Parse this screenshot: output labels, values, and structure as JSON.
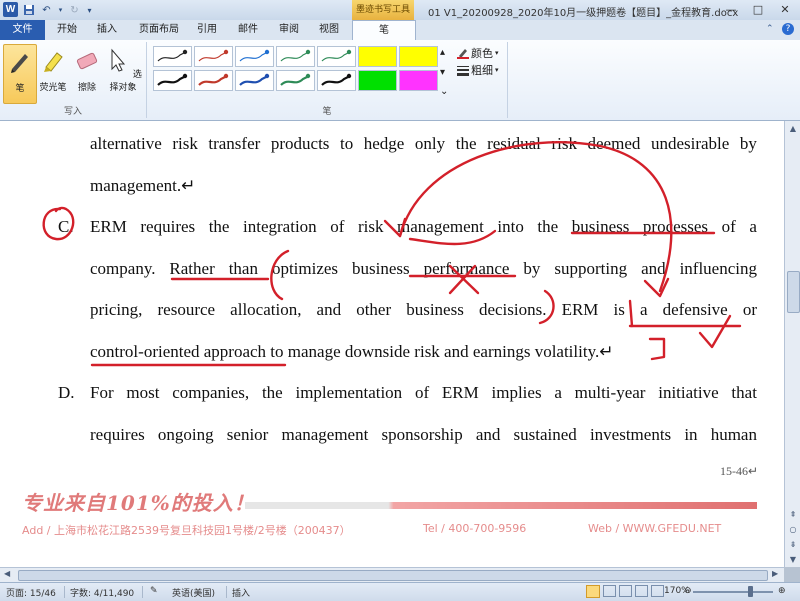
{
  "titlebar": {
    "app_icon": "W",
    "document_title": "01 V1_20200928_2020年10月一级押题卷【题目】_金程教育.docx",
    "context_tab_title": "墨迹书写工具",
    "window_controls": {
      "minimize": "—",
      "maximize": "□",
      "close": "✕"
    }
  },
  "tabs": {
    "file": "文件",
    "home": "开始",
    "insert": "插入",
    "page_layout": "页面布局",
    "references": "引用",
    "mailings": "邮件",
    "review": "审阅",
    "view": "视图",
    "pen": "笔"
  },
  "ribbon": {
    "write_group": {
      "label": "写入",
      "pen": "笔",
      "highlighter": "荧光笔",
      "eraser": "擦除",
      "select": "选择对象"
    },
    "pens_group": {
      "label": "笔",
      "color": "颜色",
      "weight": "粗细",
      "swatch_colors": [
        "#222222",
        "#c0392b",
        "#1f6fd1",
        "#2e8b57",
        "#2e8b57",
        "#ffff00",
        "#ffff00",
        "#111111",
        "#c0392b",
        "#1f4fb0",
        "#2e8b57",
        "#111111",
        "#00e000",
        "#ff33ff"
      ]
    }
  },
  "document": {
    "lines": [
      [
        "alternative",
        "risk",
        "transfer",
        "products",
        "to",
        "hedge",
        "only",
        "the",
        "residual",
        "risk",
        "deemed",
        "undesirable",
        "by"
      ],
      "management.↵",
      [
        "ERM",
        "requires",
        "the",
        "integration",
        "of",
        "risk",
        "management",
        "into",
        "the",
        "business",
        "processes",
        "of",
        "a"
      ],
      [
        "company.",
        "Rather",
        "than",
        "optimizes",
        "business",
        "performance",
        "by",
        "supporting",
        "and",
        "influencing"
      ],
      [
        "pricing,",
        "resource",
        "allocation,",
        "and",
        "other",
        "business",
        "decisions.",
        "ERM",
        "is",
        "a",
        "defensive",
        "or"
      ],
      "control-oriented approach to manage downside risk and earnings volatility.↵",
      [
        "For",
        "most",
        "companies,",
        "the",
        "implementation",
        "of",
        "ERM",
        "implies",
        "a",
        "multi-year",
        "initiative",
        "that"
      ],
      [
        "requires",
        "ongoing",
        "senior",
        "management",
        "sponsorship",
        "and",
        "sustained",
        "investments",
        "in",
        "human"
      ]
    ],
    "option_c": "C.",
    "option_d": "D.",
    "page_number": "15-46↵",
    "slogan": "专业来自101%的投入！",
    "footer": {
      "address": "Add / 上海市松花江路2539号复旦科技园1号楼/2号楼（200437）",
      "tel": "Tel / 400-700-9596",
      "web": "Web / WWW.GFEDU.NET"
    }
  },
  "statusbar": {
    "page": "页面: 15/46",
    "words": "字数: 4/11,490",
    "language": "英语(美国)",
    "mode": "插入",
    "zoom": "170%"
  },
  "colors": {
    "ink_red": "#d3202a",
    "file_tab": "#2a5db0",
    "slogan": "#e07a7a"
  }
}
